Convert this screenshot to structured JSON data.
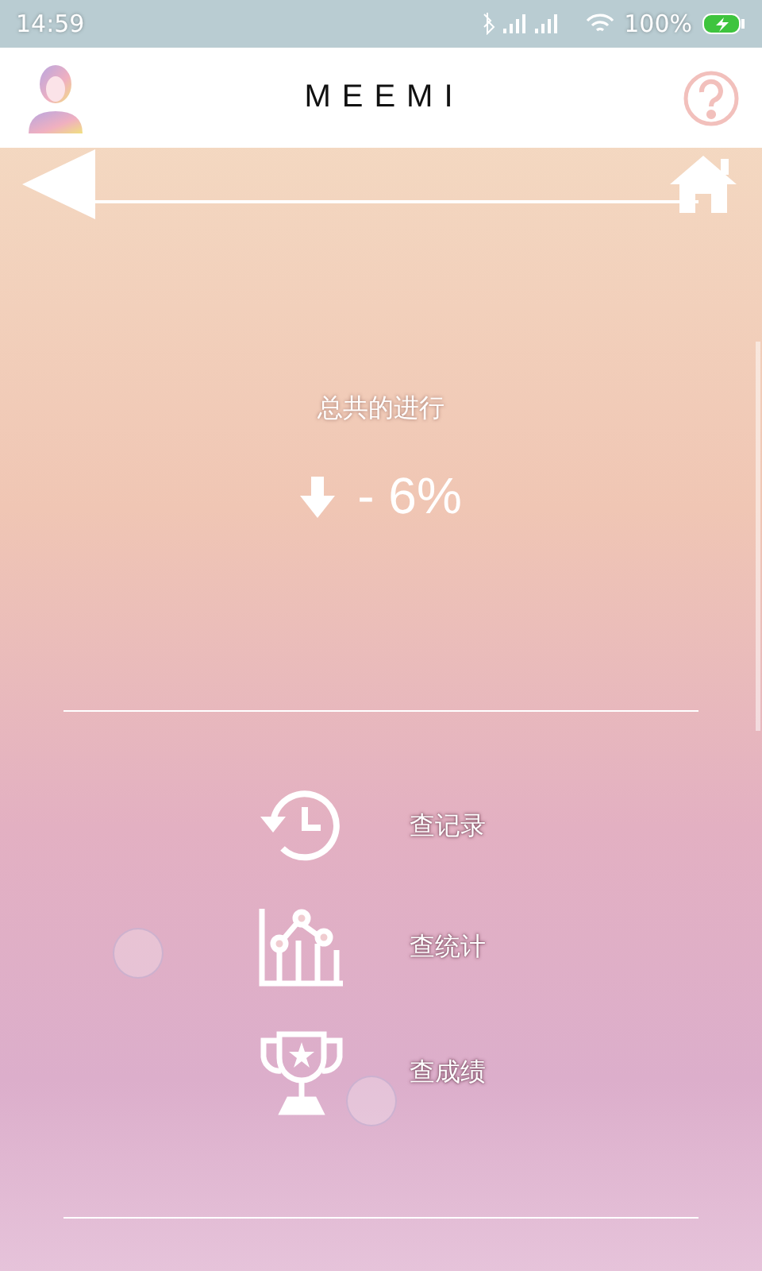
{
  "status_bar": {
    "time": "14:59",
    "battery": "100%"
  },
  "header": {
    "title": "MEEMI"
  },
  "progress": {
    "label": "总共的进行",
    "value": "- 6%"
  },
  "menu": [
    {
      "kind": "history",
      "label": "查记录"
    },
    {
      "kind": "stats",
      "label": "查统计"
    },
    {
      "kind": "trophy",
      "label": "查成绩"
    }
  ]
}
